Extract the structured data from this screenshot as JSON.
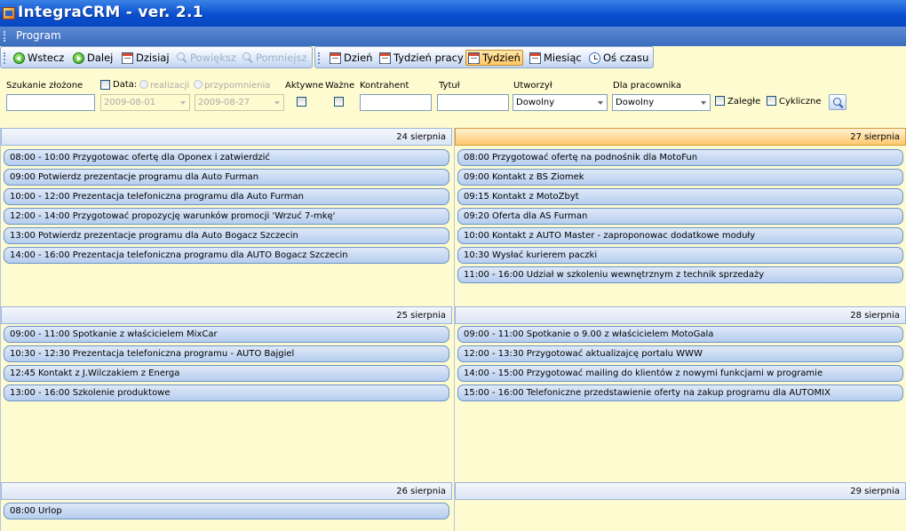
{
  "app": {
    "title": "IntegraCRM - ver. 2.1"
  },
  "menu": {
    "items": [
      "Program"
    ]
  },
  "toolbar": {
    "back": "Wstecz",
    "forward": "Dalej",
    "today": "Dzisiaj",
    "zoom_in": "Powiększ",
    "zoom_out": "Pomniejsz",
    "day": "Dzień",
    "work_week": "Tydzień pracy",
    "week": "Tydzień",
    "month": "Miesiąc",
    "timeline": "Oś czasu",
    "active_view": "Tydzień"
  },
  "filters": {
    "complex_search_label": "Szukanie złożone",
    "complex_search_value": "",
    "date_label": "Data:",
    "date_opt_realization": "realizacji",
    "date_opt_reminder": "przypomnienia",
    "date_from": "2009-08-01",
    "date_to": "2009-08-27",
    "active_label": "Aktywne",
    "important_label": "Ważne",
    "contractor_label": "Kontrahent",
    "contractor_value": "",
    "title_label": "Tytuł",
    "title_value": "",
    "created_label": "Utworzył",
    "created_value": "Dowolny",
    "employee_label": "Dla pracownika",
    "employee_value": "Dowolny",
    "overdue_label": "Zaległe",
    "cyclic_label": "Cykliczne"
  },
  "calendar": {
    "days": [
      {
        "date": "24 sierpnia",
        "events": [
          "08:00 - 10:00 Przygotowac ofertę dla Oponex i zatwierdzić",
          "09:00 Potwierdz prezentacje programu dla Auto Furman",
          "10:00 - 12:00 Prezentacja telefoniczna programu dla Auto Furman",
          "12:00 - 14:00 Przygotować propozycję warunków promocji 'Wrzuć 7-mkę'",
          "13:00 Potwierdz prezentacje programu dla Auto Bogacz Szczecin",
          "14:00 - 16:00 Prezentacja telefoniczna programu dla AUTO Bogacz Szczecin"
        ]
      },
      {
        "date": "25 sierpnia",
        "events": [
          "09:00 - 11:00 Spotkanie z właścicielem MixCar",
          "10:30 - 12:30 Prezentacja telefoniczna programu - AUTO Bajgiel",
          "12:45 Kontakt z J.Wilczakiem z Energa",
          "13:00 - 16:00 Szkolenie produktowe"
        ]
      },
      {
        "date": "26 sierpnia",
        "events": [
          "08:00 Urlop"
        ]
      },
      {
        "date": "27 sierpnia",
        "today": true,
        "events": [
          "08:00 Przygotować ofertę na podnośnik dla MotoFun",
          "09:00 Kontakt z BS Ziomek",
          "09:15 Kontakt z MotoZbyt",
          "09:20 Oferta dla AS Furman",
          "10:00 Kontakt z AUTO Master - zaproponowac dodatkowe moduły",
          "10:30 Wysłać kurierem paczki",
          "11:00 - 16:00 Udział w szkoleniu wewnętrznym z technik sprzedaży"
        ]
      },
      {
        "date": "28 sierpnia",
        "events": [
          "09:00 - 11:00 Spotkanie o 9.00 z właścicielem MotoGala",
          "12:00 - 13:30 Przygotować aktualizajcę portalu WWW",
          "14:00 - 15:00 Przygotować mailing do klientów z nowymi funkcjami w programie",
          "15:00 - 16:00 Telefoniczne przedstawienie oferty na zakup programu dla AUTOMIX"
        ]
      },
      {
        "date": "29 sierpnia",
        "events": []
      }
    ]
  }
}
